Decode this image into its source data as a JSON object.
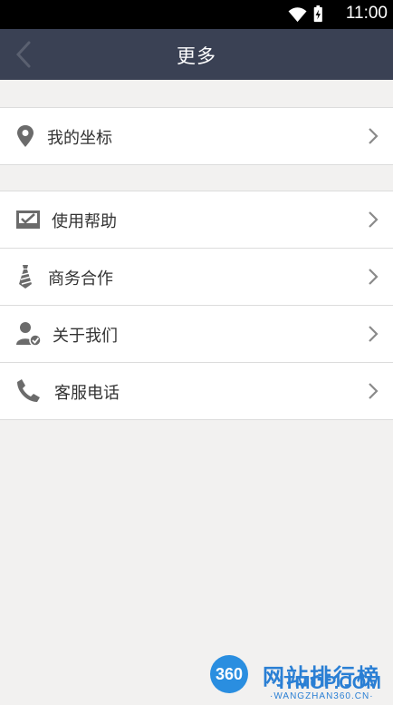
{
  "status_bar": {
    "time": "11:00",
    "icons": [
      "wifi-icon",
      "battery-charging-icon"
    ]
  },
  "nav": {
    "title": "更多",
    "back_icon": "back-chevron-icon"
  },
  "groups": [
    {
      "items": [
        {
          "label": "我的坐标",
          "icon": "location-pin-icon"
        }
      ]
    },
    {
      "items": [
        {
          "label": "使用帮助",
          "icon": "help-inbox-icon"
        },
        {
          "label": "商务合作",
          "icon": "tie-icon"
        },
        {
          "label": "关于我们",
          "icon": "user-check-icon"
        },
        {
          "label": "客服电话",
          "icon": "phone-icon"
        }
      ]
    }
  ],
  "watermark": {
    "logo": "360",
    "text_line1": "网站排行榜",
    "text_line2": "ITMOP.COM",
    "sub": "·WANGZHAN360.CN·"
  },
  "colors": {
    "navbar": "#3a4154",
    "background": "#f2f1f0",
    "icon": "#6b6b6b",
    "watermark": "#2a7fd4"
  }
}
